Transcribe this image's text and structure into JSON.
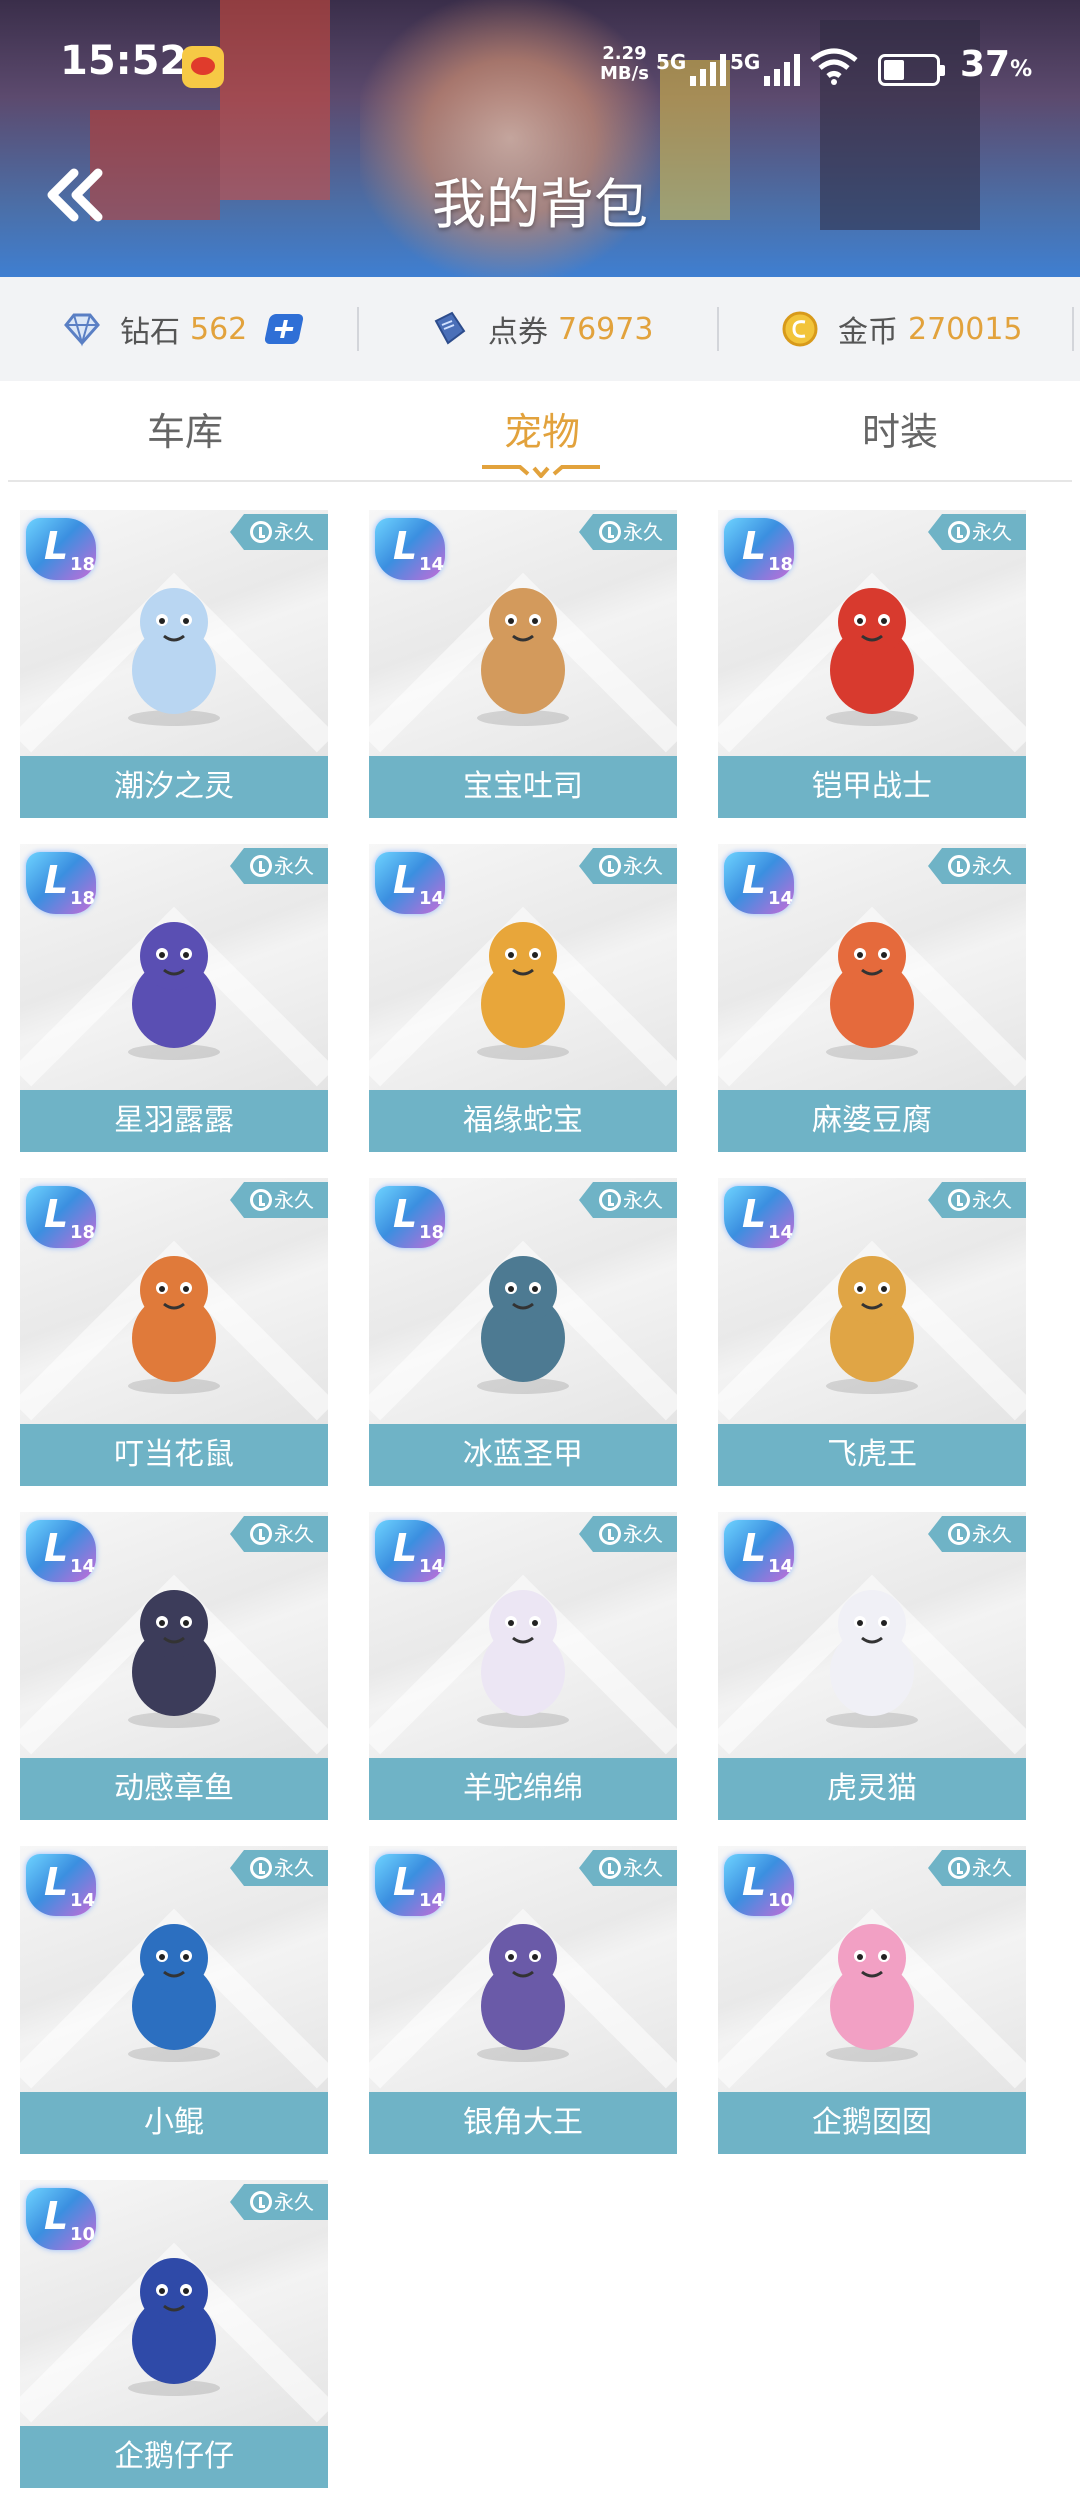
{
  "status_bar": {
    "time": "15:52",
    "net_speed_value": "2.29",
    "net_speed_unit": "MB/s",
    "signal_1": "5G",
    "signal_2": "5G",
    "battery": "37",
    "battery_unit": "%"
  },
  "header": {
    "title": "我的背包",
    "back_icon": "double-chevron-left-icon"
  },
  "currency": [
    {
      "label": "钻石",
      "value": "562",
      "icon": "diamond-icon",
      "color": "#e2a23c"
    },
    {
      "label": "点券",
      "value": "76973",
      "icon": "ticket-icon",
      "color": "#e2a23c"
    },
    {
      "label": "金币",
      "value": "270015",
      "icon": "coin-icon",
      "color": "#e2a23c"
    }
  ],
  "tabs": [
    {
      "label": "车库",
      "active": false
    },
    {
      "label": "宠物",
      "active": true
    },
    {
      "label": "时装",
      "active": false
    }
  ],
  "badge_text": "永久",
  "colors": {
    "accent": "#e2a23c",
    "card_label_bg": "#6fb3c6"
  },
  "pets": [
    {
      "name": "潮汐之灵",
      "level": "18",
      "color": "#b9d6f2"
    },
    {
      "name": "宝宝吐司",
      "level": "14",
      "color": "#d39a5c"
    },
    {
      "name": "铠甲战士",
      "level": "18",
      "color": "#d83a2e"
    },
    {
      "name": "星羽露露",
      "level": "18",
      "color": "#5a4fb3"
    },
    {
      "name": "福缘蛇宝",
      "level": "14",
      "color": "#e8a63a"
    },
    {
      "name": "麻婆豆腐",
      "level": "14",
      "color": "#e56a3c"
    },
    {
      "name": "叮当花鼠",
      "level": "18",
      "color": "#e07a3a"
    },
    {
      "name": "冰蓝圣甲",
      "level": "18",
      "color": "#4d7a92"
    },
    {
      "name": "飞虎王",
      "level": "14",
      "color": "#e0a545"
    },
    {
      "name": "动感章鱼",
      "level": "14",
      "color": "#3c3c5a"
    },
    {
      "name": "羊驼绵绵",
      "level": "14",
      "color": "#ece6f4"
    },
    {
      "name": "虎灵猫",
      "level": "14",
      "color": "#f0f0f6"
    },
    {
      "name": "小鲲",
      "level": "14",
      "color": "#2c6fc0"
    },
    {
      "name": "银角大王",
      "level": "14",
      "color": "#6a5aa8"
    },
    {
      "name": "企鹅囡囡",
      "level": "10",
      "color": "#f2a0c4"
    },
    {
      "name": "企鹅仔仔",
      "level": "10",
      "color": "#2f4aa8"
    }
  ]
}
